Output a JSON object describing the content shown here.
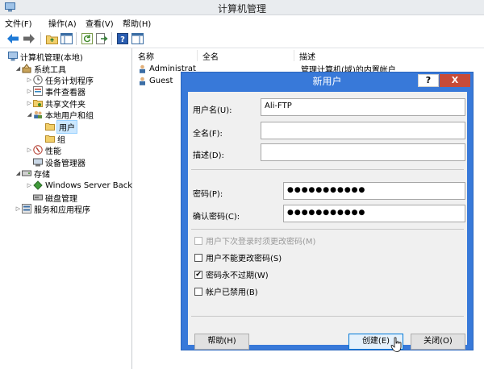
{
  "window": {
    "title": "计算机管理"
  },
  "menu": {
    "items": [
      "文件(F)",
      "操作(A)",
      "查看(V)",
      "帮助(H)"
    ]
  },
  "toolbar": {
    "icons": [
      "back-arrow-icon",
      "forward-arrow-icon",
      "folder-up-icon",
      "show-tree-icon",
      "refresh-icon",
      "export-icon",
      "help-icon",
      "properties-icon"
    ],
    "colors": {
      "back": "#1f7ad6",
      "forward": "#6a6a6a"
    }
  },
  "tree": {
    "nodes": [
      {
        "label": "计算机管理(本地)",
        "icon": "computer-icon"
      },
      {
        "label": "系统工具",
        "icon": "tools-icon"
      },
      {
        "label": "任务计划程序",
        "icon": "clock-icon"
      },
      {
        "label": "事件查看器",
        "icon": "event-log-icon"
      },
      {
        "label": "共享文件夹",
        "icon": "shared-folder-icon"
      },
      {
        "label": "本地用户和组",
        "icon": "users-group-icon"
      },
      {
        "label": "用户",
        "icon": "folder-icon",
        "selected": true
      },
      {
        "label": "组",
        "icon": "folder-icon"
      },
      {
        "label": "性能",
        "icon": "performance-icon"
      },
      {
        "label": "设备管理器",
        "icon": "device-manager-icon"
      },
      {
        "label": "存储",
        "icon": "storage-icon"
      },
      {
        "label": "Windows Server Back",
        "icon": "backup-icon"
      },
      {
        "label": "磁盘管理",
        "icon": "disk-icon"
      },
      {
        "label": "服务和应用程序",
        "icon": "services-icon"
      }
    ]
  },
  "list": {
    "columns": [
      "名称",
      "全名",
      "描述"
    ],
    "rows": [
      {
        "name": "Administrat",
        "fullname": "",
        "desc": "管理计算机(域)的内置帐户"
      },
      {
        "name": "Guest",
        "fullname": "",
        "desc": ""
      }
    ]
  },
  "dialog": {
    "title": "新用户",
    "help_label": "?",
    "close_label": "X",
    "fields": {
      "username_label": "用户名(U):",
      "username_value": "Ali-FTP",
      "fullname_label": "全名(F):",
      "fullname_value": "",
      "desc_label": "描述(D):",
      "desc_value": "",
      "password_label": "密码(P):",
      "password_value": "●●●●●●●●●●●",
      "confirm_label": "确认密码(C):",
      "confirm_value": "●●●●●●●●●●●"
    },
    "checkboxes": [
      {
        "label": "用户下次登录时须更改密码(M)",
        "checked": false,
        "disabled": true
      },
      {
        "label": "用户不能更改密码(S)",
        "checked": false,
        "disabled": false
      },
      {
        "label": "密码永不过期(W)",
        "checked": true,
        "disabled": false
      },
      {
        "label": "帐户已禁用(B)",
        "checked": false,
        "disabled": false
      }
    ],
    "check_mark": "✔",
    "buttons": {
      "help": "帮助(H)",
      "create": "创建(E)",
      "close": "关闭(O)"
    },
    "colors": {
      "frame": "#3879d9",
      "close": "#c74b38"
    }
  }
}
